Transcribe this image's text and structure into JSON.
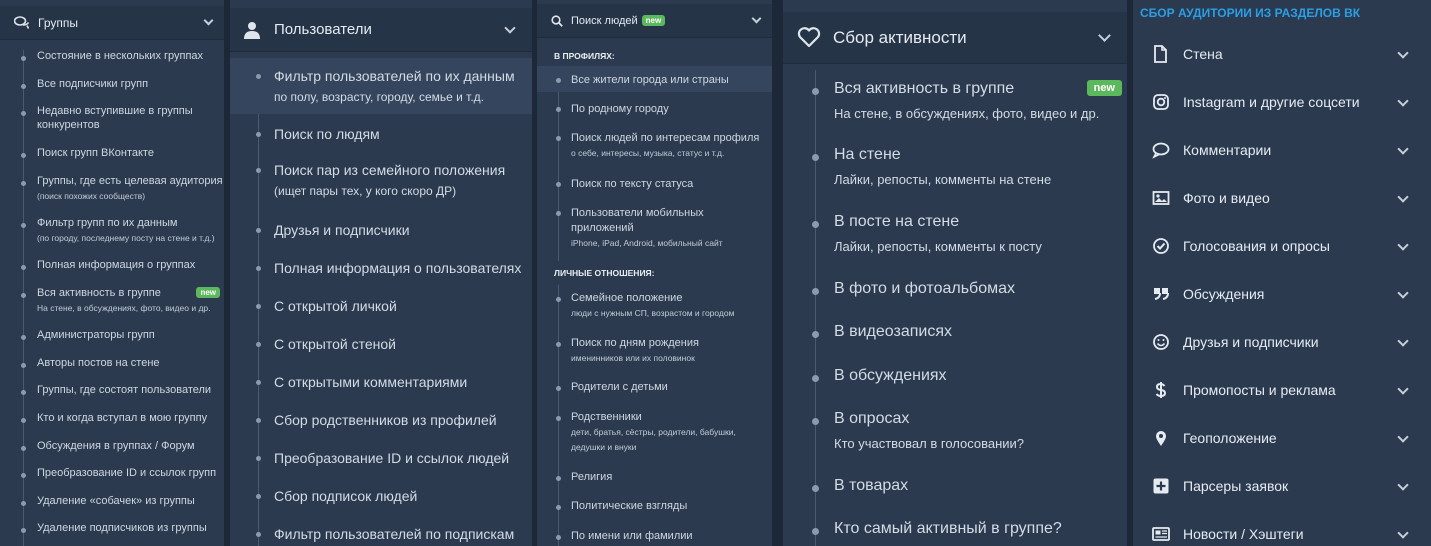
{
  "groups_panel": {
    "title": "Группы",
    "items": [
      {
        "label": "Состояние в нескольких группах"
      },
      {
        "label": "Все подписчики групп"
      },
      {
        "label": "Недавно вступившие в группы",
        "label2": "конкурентов"
      },
      {
        "label": "Поиск групп ВКонтакте"
      },
      {
        "label": "Группы, где есть целевая аудитория",
        "sub": "(поиск похожих сообществ)"
      },
      {
        "label": "Фильтр групп по их данным",
        "sub": "(по городу, последнему посту на стене и т.д.)"
      },
      {
        "label": "Полная информация о группах"
      },
      {
        "label": "Вся активность в группе",
        "sub": "На стене, в обсуждениях, фото, видео и др.",
        "badge": "new"
      },
      {
        "label": "Администраторы групп"
      },
      {
        "label": "Авторы постов на стене"
      },
      {
        "label": "Группы, где состоят пользователи"
      },
      {
        "label": "Кто и когда вступал в мою группу"
      },
      {
        "label": "Обсуждения в группах / Форум"
      },
      {
        "label": "Преобразование ID и ссылок групп"
      },
      {
        "label": "Удаление «собачек» из группы"
      },
      {
        "label": "Удаление подписчиков из группы"
      }
    ]
  },
  "users_panel": {
    "title": "Пользователи",
    "items": [
      {
        "label": "Фильтр пользователей по их данным",
        "sub": "по полу, возрасту, городу, семье и т.д."
      },
      {
        "label": "Поиск по людям"
      },
      {
        "label": "Поиск пар из семейного положения",
        "sub": "(ищет пары тех, у кого скоро ДР)"
      },
      {
        "label": "Друзья и подписчики"
      },
      {
        "label": "Полная информация о пользователях"
      },
      {
        "label": "С открытой личкой"
      },
      {
        "label": "С открытой стеной"
      },
      {
        "label": "С открытыми комментариями"
      },
      {
        "label": "Сбор родственников из профилей"
      },
      {
        "label": "Преобразование ID и ссылок людей"
      },
      {
        "label": "Сбор подписок людей"
      },
      {
        "label": "Фильтр пользователей по подпискам"
      }
    ]
  },
  "people_panel": {
    "title": "Поиск людей",
    "badge": "new",
    "section_profiles": "В ПРОФИЛЯХ:",
    "profiles": [
      {
        "label": "Все жители города или страны"
      },
      {
        "label": "По родному городу"
      },
      {
        "label": "Поиск людей по интересам профиля",
        "sub": "о себе, интересы, музыка, статус и т.д."
      },
      {
        "label": "Поиск по тексту статуса"
      },
      {
        "label": "Пользователи мобильных",
        "label2": "приложений",
        "sub": "iPhone, iPad, Android, мобильный сайт"
      }
    ],
    "section_personal": "ЛИЧНЫЕ ОТНОШЕНИЯ:",
    "personal": [
      {
        "label": "Семейное положение",
        "sub": "люди с нужным СП, возрастом и городом"
      },
      {
        "label": "Поиск по дням рождения",
        "sub": "именинников или их половинок"
      },
      {
        "label": "Родители с детьми"
      },
      {
        "label": "Родственники",
        "sub": "дети, братья, сёстры, родители, бабушки,",
        "sub2": "дедушки и внуки"
      },
      {
        "label": "Религия"
      },
      {
        "label": "Политические взгляды"
      },
      {
        "label": "По имени или фамилии"
      }
    ]
  },
  "activity_panel": {
    "title": "Сбор активности",
    "items": [
      {
        "label": "Вся активность в группе",
        "sub": "На стене, в обсуждениях, фото, видео и др.",
        "badge": "new"
      },
      {
        "label": "На стене",
        "sub": "Лайки, репосты, комменты на стене"
      },
      {
        "label": "В посте на стене",
        "sub": "Лайки, репосты, комменты к посту"
      },
      {
        "label": "В фото и фотоальбомах"
      },
      {
        "label": "В видеозаписях"
      },
      {
        "label": "В обсуждениях"
      },
      {
        "label": "В опросах",
        "sub": "Кто участвовал в голосовании?"
      },
      {
        "label": "В товарах"
      },
      {
        "label": "Кто самый активный в группе?"
      }
    ]
  },
  "sections_panel": {
    "title": "СБОР АУДИТОРИИ ИЗ РАЗДЕЛОВ ВК",
    "items": [
      {
        "label": "Стена",
        "icon": "file-icon"
      },
      {
        "label": "Instagram и другие соцсети",
        "icon": "instagram-icon"
      },
      {
        "label": "Комментарии",
        "icon": "comment-icon"
      },
      {
        "label": "Фото и видео",
        "icon": "image-icon"
      },
      {
        "label": "Голосования и опросы",
        "icon": "check-circle-icon"
      },
      {
        "label": "Обсуждения",
        "icon": "quote-icon"
      },
      {
        "label": "Друзья и подписчики",
        "icon": "smile-icon"
      },
      {
        "label": "Промопосты и реклама",
        "icon": "dollar-icon"
      },
      {
        "label": "Геоположение",
        "icon": "map-pin-icon"
      },
      {
        "label": "Парсеры заявок",
        "icon": "plus-square-icon"
      },
      {
        "label": "Новости / Хэштеги",
        "icon": "newspaper-icon"
      }
    ]
  },
  "colors": {
    "panel": "#2b3a4f",
    "header": "#263447",
    "accent_title": "#2b9fe6",
    "badge": "#5cb85c"
  }
}
